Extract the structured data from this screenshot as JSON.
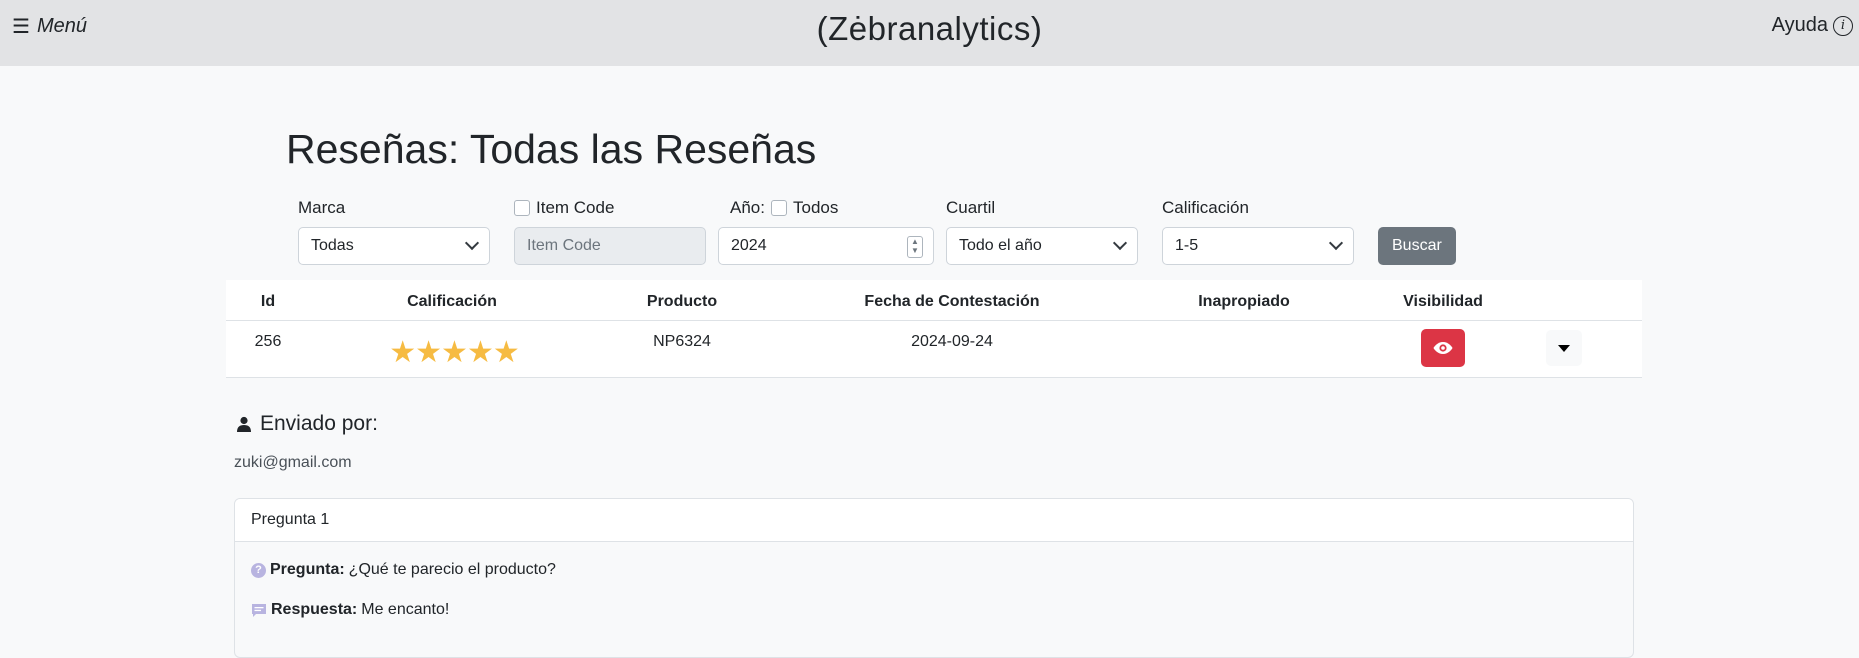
{
  "header": {
    "menu_label": "Menú",
    "brand": "(Zėbranalytics)",
    "help_label": "Ayuda"
  },
  "page_title": "Reseñas: Todas las Reseñas",
  "filters": {
    "marca": {
      "label": "Marca",
      "value": "Todas"
    },
    "item_code": {
      "label": "Item Code",
      "placeholder": "Item Code",
      "checked": false
    },
    "anio": {
      "label": "Año:",
      "all_label": "Todos",
      "value": "2024",
      "checked": false
    },
    "cuartil": {
      "label": "Cuartil",
      "value": "Todo el año"
    },
    "calificacion": {
      "label": "Calificación",
      "value": "1-5"
    },
    "search_label": "Buscar"
  },
  "table": {
    "columns": [
      "Id",
      "Calificación",
      "Producto",
      "Fecha de Contestación",
      "Inapropiado",
      "Visibilidad"
    ],
    "rows": [
      {
        "id": "256",
        "rating": 5,
        "rating_stars": "★★★★★",
        "product": "NP6324",
        "date": "2024-09-24",
        "inappropriate": "",
        "visibility_icon": "eye-icon"
      }
    ]
  },
  "detail": {
    "sent_by_label": "Enviado por:",
    "email": "zuki@gmail.com",
    "question_card": {
      "header": "Pregunta 1",
      "question_label": "Pregunta:",
      "question_text": "¿Qué te parecio el producto?",
      "answer_label": "Respuesta:",
      "answer_text": "Me encanto!"
    }
  },
  "colors": {
    "topbar": "#e2e3e5",
    "star": "#f6bb42",
    "visibility_button": "#dc3545",
    "search_button": "#6c757d"
  }
}
